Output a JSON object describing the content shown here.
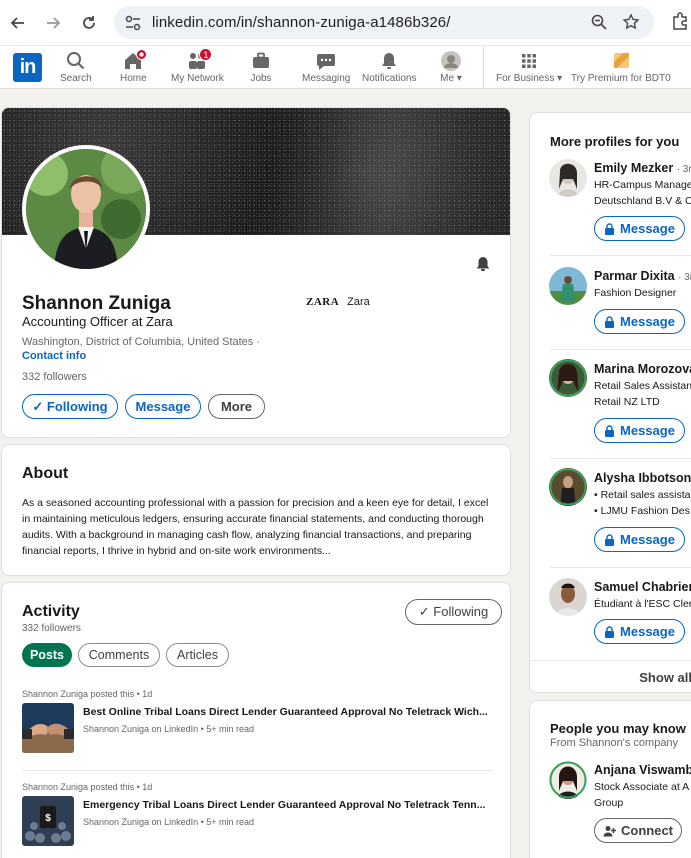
{
  "browser": {
    "url": "linkedin.com/in/shannon-zuniga-a1486b326/"
  },
  "nav": {
    "items": [
      {
        "label": "Search",
        "icon": "search-icon"
      },
      {
        "label": "Home",
        "icon": "home-icon",
        "badge": ""
      },
      {
        "label": "My Network",
        "icon": "network-icon",
        "badge": "1"
      },
      {
        "label": "Jobs",
        "icon": "briefcase-icon"
      },
      {
        "label": "Messaging",
        "icon": "messaging-icon"
      },
      {
        "label": "Notifications",
        "icon": "bell-icon"
      },
      {
        "label": "Me ▾",
        "icon": "avatar"
      },
      {
        "label": "For Business ▾",
        "icon": "grid-icon"
      },
      {
        "label": "Try Premium for BDT0",
        "icon": "premium-icon"
      }
    ]
  },
  "profile": {
    "name": "Shannon Zuniga",
    "headline": "Accounting Officer at Zara",
    "location": "Washington, District of Columbia, United States ·",
    "contact_info": "Contact info",
    "followers": "332 followers",
    "company_logo": "ZARA",
    "company": "Zara",
    "buttons": {
      "following": "✓ Following",
      "message": "Message",
      "more": "More"
    }
  },
  "about": {
    "title": "About",
    "text": "As a seasoned accounting professional with a passion for precision and a keen eye for detail, I excel in maintaining meticulous ledgers, ensuring accurate financial statements, and conducting thorough audits. With a background in managing cash flow, analyzing financial transactions, and preparing financial reports, I thrive in hybrid and on-site work environments..."
  },
  "activity": {
    "title": "Activity",
    "followers": "332 followers",
    "following_button": "✓ Following",
    "tabs": [
      "Posts",
      "Comments",
      "Articles"
    ],
    "posts": [
      {
        "meta": "Shannon Zuniga posted this • 1d",
        "title": "Best Online Tribal Loans Direct Lender Guaranteed Approval No Teletrack Wich...",
        "sub": "Shannon Zuniga on LinkedIn • 5+ min read"
      },
      {
        "meta": "Shannon Zuniga posted this • 1d",
        "title": "Emergency Tribal Loans Direct Lender Guaranteed Approval No Teletrack Tenn...",
        "sub": "Shannon Zuniga on LinkedIn • 5+ min read"
      }
    ]
  },
  "more_profiles": {
    "title": "More profiles for you",
    "message_label": "Message",
    "show_all": "Show all",
    "people": [
      {
        "name": "Emily Mezker",
        "degree": "· 3rd",
        "desc": [
          "HR-Campus Manage",
          "Deutschland B.V & C"
        ]
      },
      {
        "name": "Parmar Dixita",
        "degree": "· 3rd",
        "desc": [
          "Fashion Designer"
        ]
      },
      {
        "name": "Marina Morozova",
        "degree": "",
        "desc": [
          "Retail Sales Assistan",
          "Retail NZ LTD"
        ]
      },
      {
        "name": "Alysha Ibbotson",
        "degree": "",
        "desc": [
          "• Retail sales assista",
          "• LJMU Fashion Des"
        ]
      },
      {
        "name": "Samuel Chabrier",
        "degree": "",
        "desc": [
          "Étudiant à l'ESC Cler"
        ]
      }
    ]
  },
  "people_you_may_know": {
    "title": "People you may know",
    "subtitle": "From Shannon's company",
    "person": {
      "name": "Anjana Viswamba",
      "desc": [
        "Stock Associate at A",
        "Group"
      ]
    },
    "connect_label": "Connect"
  }
}
